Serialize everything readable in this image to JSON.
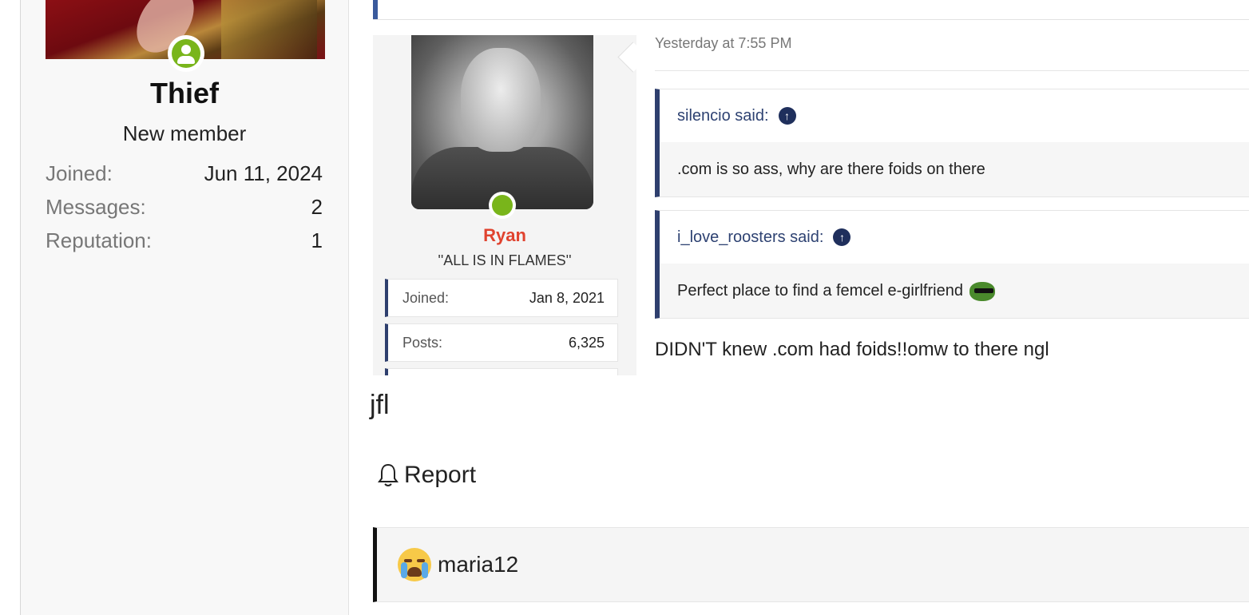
{
  "thief": {
    "name": "Thief",
    "title": "New member",
    "stats": [
      {
        "label": "Joined:",
        "value": "Jun 11, 2024"
      },
      {
        "label": "Messages:",
        "value": "2"
      },
      {
        "label": "Reputation:",
        "value": "1"
      }
    ]
  },
  "post": {
    "author": {
      "name": "Ryan",
      "title": "''ALL IS IN FLAMES''",
      "stats": [
        {
          "label": "Joined:",
          "value": "Jan 8, 2021"
        },
        {
          "label": "Posts:",
          "value": "6,325"
        }
      ]
    },
    "time": "Yesterday at 7:55 PM",
    "quotes": [
      {
        "author": "silencio said:",
        "text": ".com is so ass, why are there foids on there"
      },
      {
        "author": "i_love_roosters said:",
        "text": "Perfect place to find a femcel e-girlfriend"
      }
    ],
    "body": "DIDN'T knew .com had foids!!omw to there ngl"
  },
  "reply": {
    "text": "jfl",
    "report_label": "Report"
  },
  "reactions": {
    "user": "maria12"
  },
  "colors": {
    "accent": "#2e3f6e",
    "online": "#79b51b",
    "author_name": "#e0432f"
  }
}
